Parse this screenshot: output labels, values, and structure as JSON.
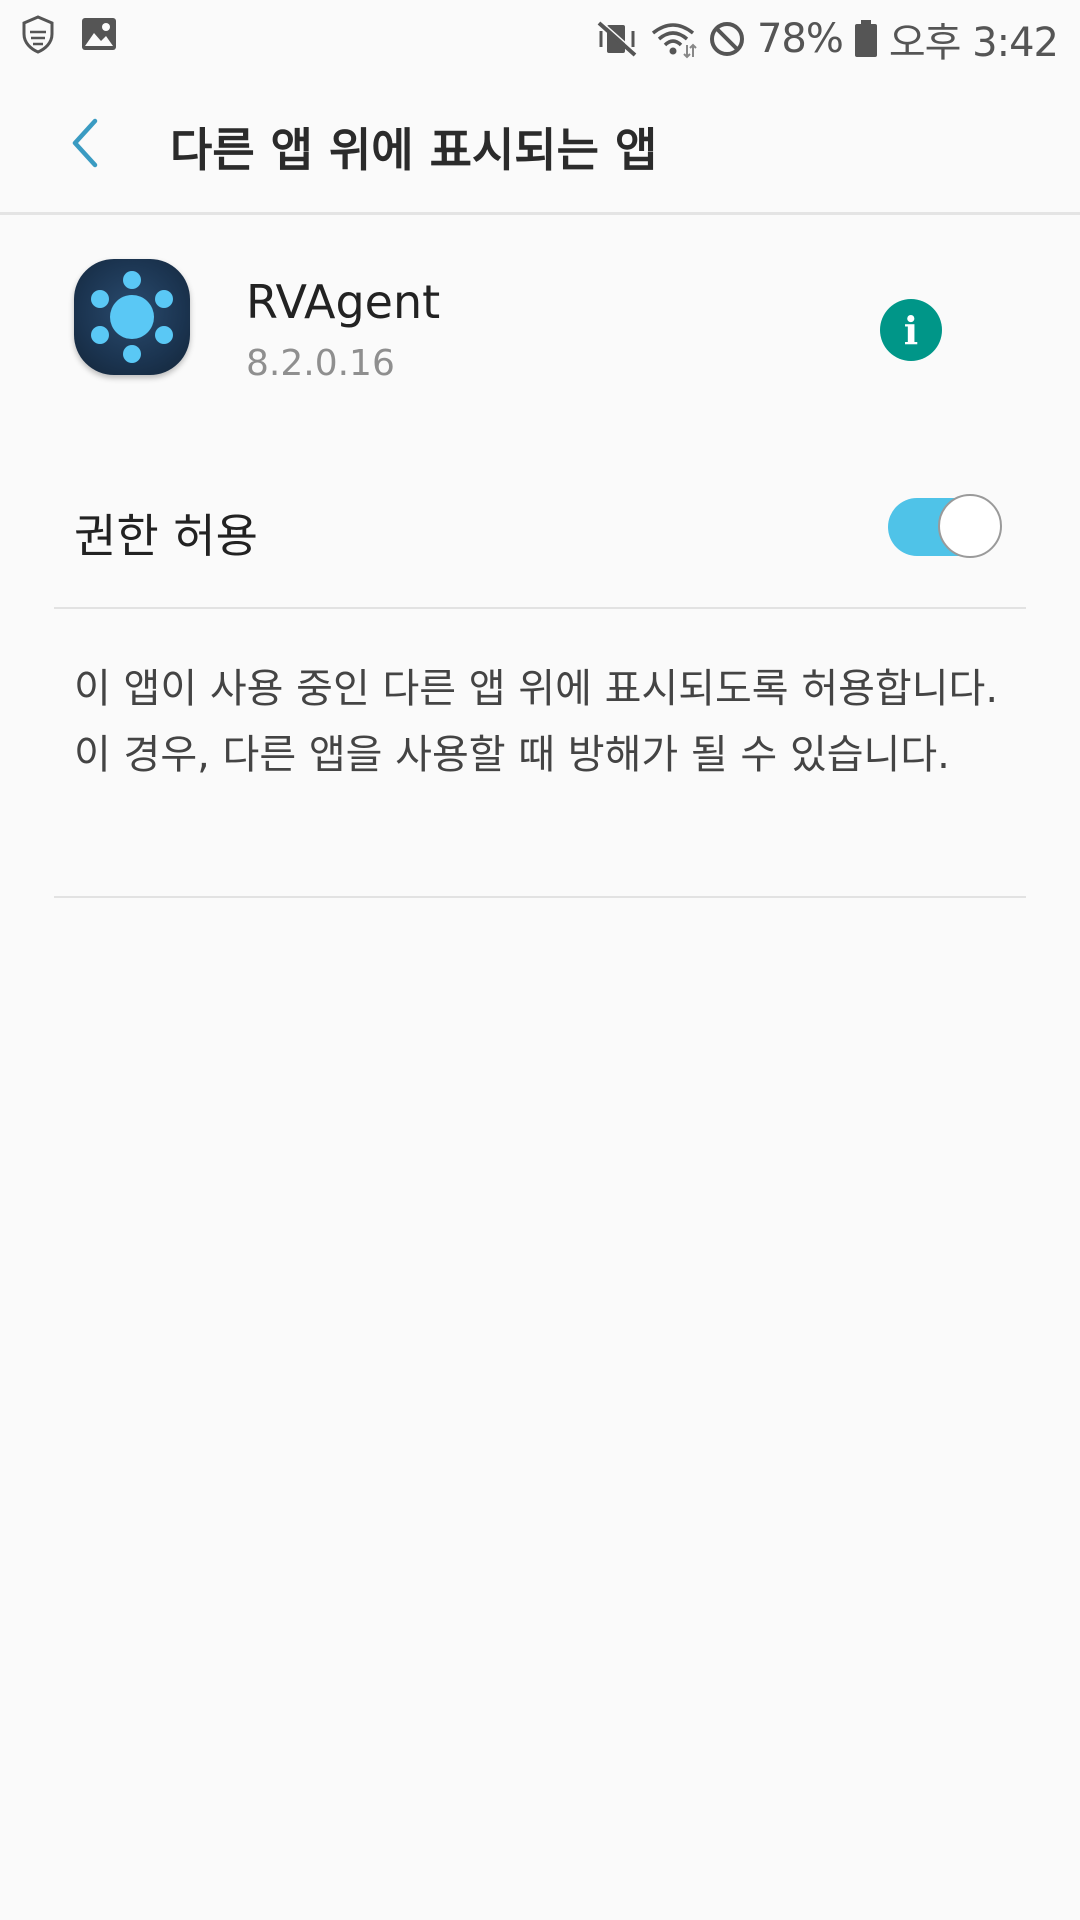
{
  "status_bar": {
    "battery_percent": "78%",
    "time": "오후 3:42",
    "icons": [
      "shield-icon",
      "image-icon",
      "vibrate-mute-icon",
      "wifi-icon",
      "do-not-disturb-icon",
      "battery-icon"
    ]
  },
  "header": {
    "back_icon": "chevron-left-icon",
    "title": "다른 앱 위에 표시되는 앱"
  },
  "app": {
    "name": "RVAgent",
    "version": "8.2.0.16",
    "info_label": "i"
  },
  "permission": {
    "label": "권한 허용",
    "enabled": true
  },
  "description": "이 앱이 사용 중인 다른 앱 위에 표시되도록 허용합니다. 이 경우, 다른 앱을 사용할 때 방해가 될 수 있습니다.",
  "colors": {
    "accent": "#4fc3e8",
    "info": "#009688",
    "back": "#3a9bc2"
  }
}
